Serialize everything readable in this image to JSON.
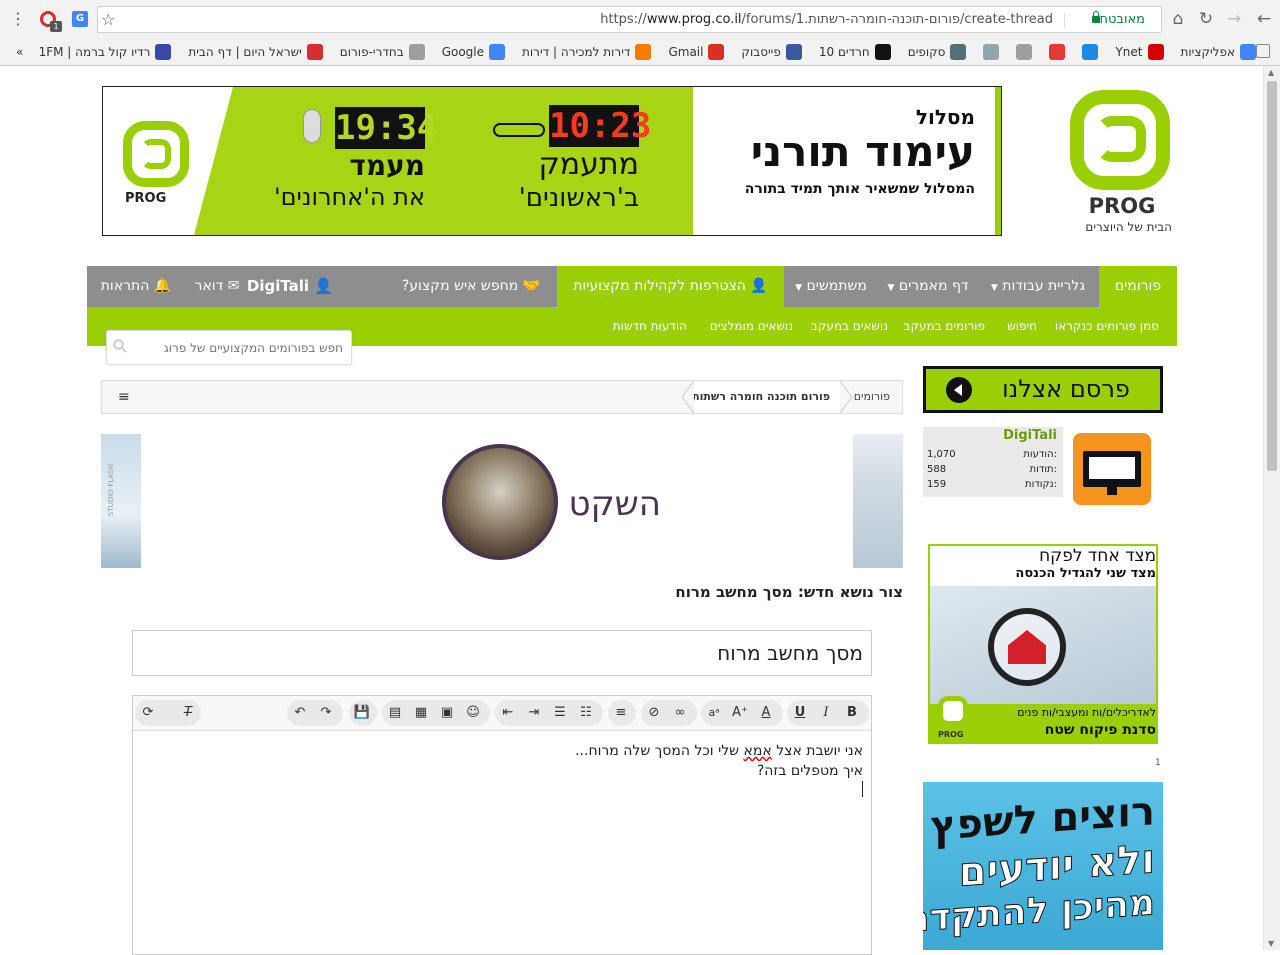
{
  "browser": {
    "url_scheme": "https://",
    "url_host": "www.prog.co.il",
    "url_path": "/forums/פורום-תוכנה-חומרה-רשתות.1/create-thread",
    "secure_label": "מאובטח",
    "ext_badge": "1",
    "bookmarks": [
      {
        "label": "אפליקציות",
        "icon": "apps-icon",
        "color": "#4285f4"
      },
      {
        "label": "Ynet",
        "icon": "ynet-icon",
        "color": "#d50000"
      },
      {
        "label": "",
        "icon": "bookmark-icon",
        "color": "#1e88e5"
      },
      {
        "label": "",
        "icon": "chrome-icon",
        "color": "#e53935"
      },
      {
        "label": "",
        "icon": "page-icon",
        "color": "#9e9e9e"
      },
      {
        "label": "",
        "icon": "r-icon",
        "color": "#90a4ae"
      },
      {
        "label": "סקופים",
        "icon": "scoops-icon",
        "color": "#546e7a"
      },
      {
        "label": "חרדים 10",
        "icon": "haredim10-icon",
        "color": "#111111"
      },
      {
        "label": "פייסבוק",
        "icon": "facebook-icon",
        "color": "#3b5998"
      },
      {
        "label": "Gmail",
        "icon": "gmail-icon",
        "color": "#d93025"
      },
      {
        "label": "דירות למכירה | דירות",
        "icon": "yad2-icon",
        "color": "#f57c00"
      },
      {
        "label": "Google",
        "icon": "google-icon",
        "color": "#4285f4"
      },
      {
        "label": "בחדרי-פורום",
        "icon": "page-icon",
        "color": "#9e9e9e"
      },
      {
        "label": "ישראל היום | דף הבית",
        "icon": "israelhayom-icon",
        "color": "#d32f2f"
      },
      {
        "label": "רדיו קול ברמה | 1FM",
        "icon": "radio-icon",
        "color": "#3949ab"
      }
    ],
    "overflow_label": "»"
  },
  "banner": {
    "left_title": "מעמד",
    "left_sub": "את ה'אחרונים'",
    "left_clock": "19:34",
    "mid_title": "מתעמק",
    "mid_sub": "ב'ראשונים'",
    "mid_clock": "10:23",
    "right_small": "מסלול",
    "right_big": "עימוד תורני",
    "right_tag": "המסלול שמשאיר אותך תמיד בתורה",
    "brand": "PROG"
  },
  "logo": {
    "brand": "PROG",
    "tagline": "הבית של היוצרים"
  },
  "mainnav": {
    "forums": "פורומים",
    "gallery": "גלריית עבודות",
    "articles": "דף מאמרים",
    "users": "משתמשים",
    "join": "הצטרפות לקהילות מקצועיות",
    "find": "מחפש איש מקצוע?",
    "user": "DigiTali",
    "mail": "דואר",
    "alerts": "התראות"
  },
  "subnav": {
    "items": [
      "סמן פורומים כנקראו",
      "חיפוש",
      "פורומים במעקב",
      "נושאים במעקב",
      "נושאים מומלצים",
      "הודעות חדשות"
    ]
  },
  "search": {
    "placeholder": "חפש בפורומים המקצועיים של פרוג"
  },
  "breadcrumb": {
    "root": "פורומים",
    "current": "פורום תוכנה חומרה רשתות"
  },
  "forum_header": {
    "name": "השקט",
    "credit": "STUDIO-FLASH"
  },
  "page": {
    "heading_prefix": "צור נושא חדש:",
    "heading_title": "מסך מחשב מרוח"
  },
  "form": {
    "title_value": "מסך מחשב מרוח"
  },
  "editor": {
    "line1_pre": "אני יושבת אצל ",
    "line1_word": "אמא",
    "line1_post": " שלי וכל המסך שלה מרוח...",
    "line2": "איך מטפלים בזה?"
  },
  "sidebar": {
    "advertise": "פרסם אצלנו",
    "username": "DigiTali",
    "stats": [
      {
        "label": "הודעות:",
        "value": "1,070"
      },
      {
        "label": "תודות:",
        "value": "588"
      },
      {
        "label": "נקודות:",
        "value": "159"
      }
    ],
    "ad1_line1": "מצד אחד לפקח",
    "ad1_line2": "מצד שני להגדיל הכנסה",
    "ad1_line3": "לאדריכלים/ות ומעצבי/ות פנים",
    "ad1_line4": "סדנת פיקוח שטח",
    "ad1_brand": "PROG",
    "ad_counter": "1",
    "ad2_line1": "רוצים לשפץ",
    "ad2_line2": "ולא יודעים",
    "ad2_line3": "מהיכן להתקדם"
  },
  "colors": {
    "green": "#9bcf05",
    "gray_nav": "#8e8e8e",
    "dark": "#111111"
  }
}
